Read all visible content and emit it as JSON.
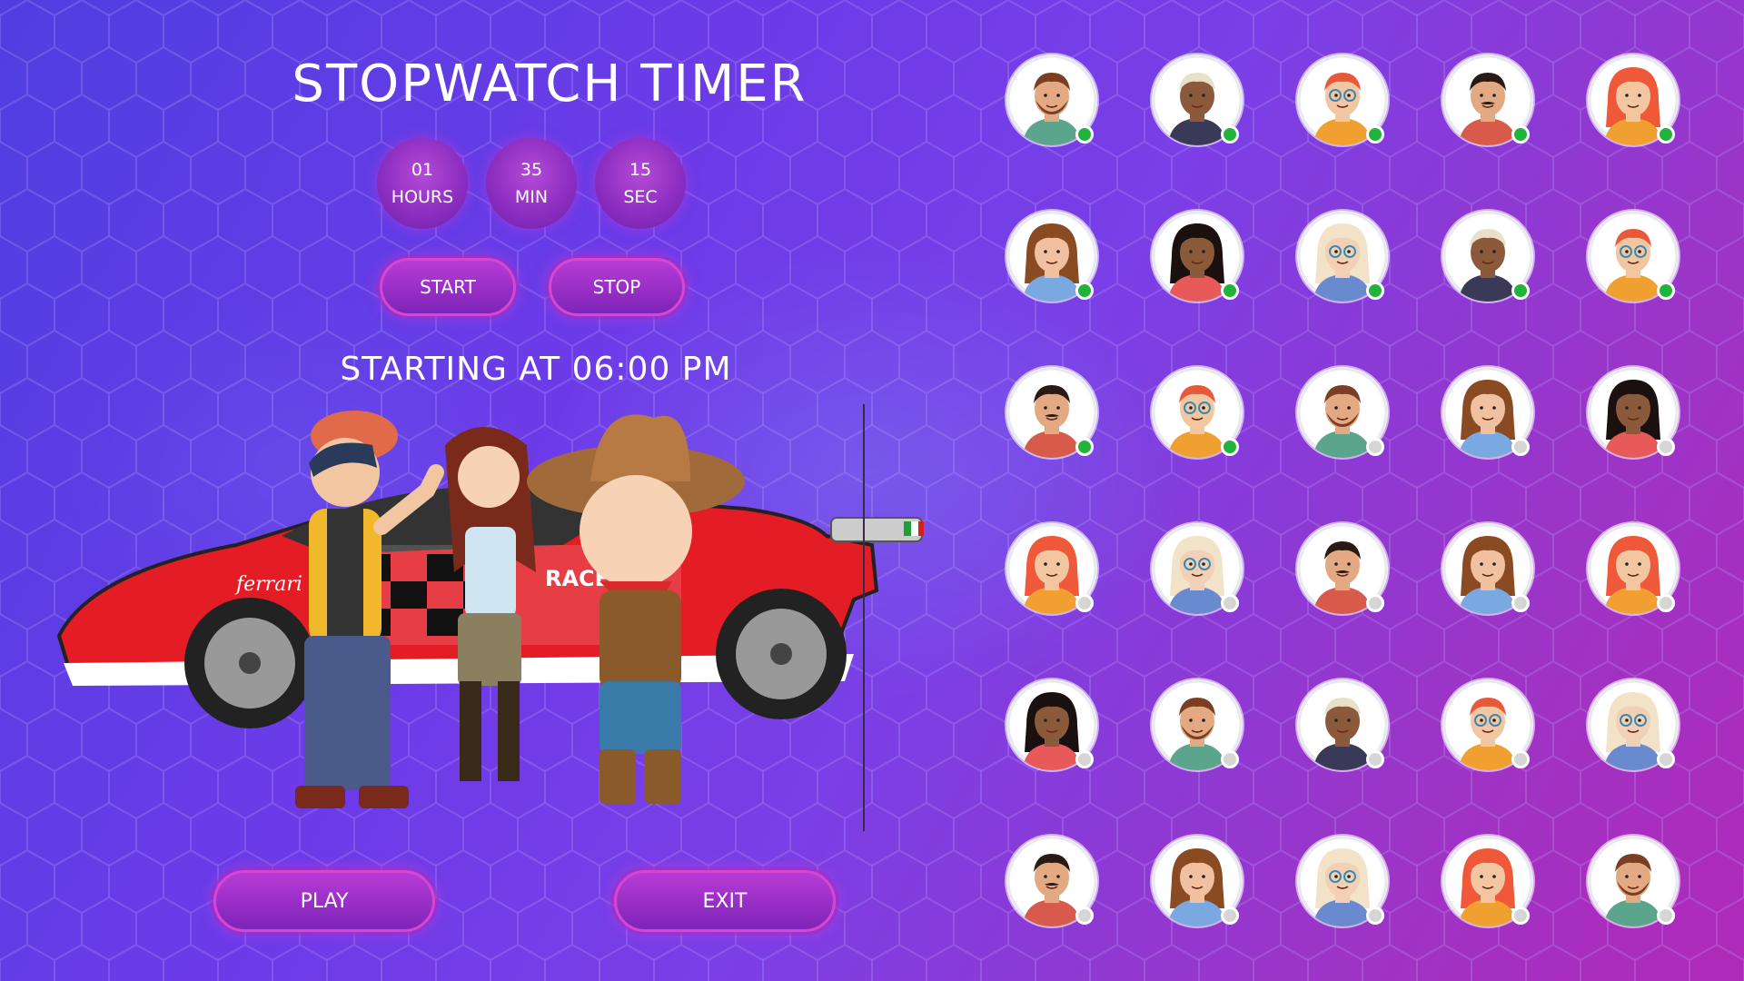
{
  "title": "STOPWATCH TIMER",
  "timer": [
    {
      "value": "01",
      "unit": "HOURS"
    },
    {
      "value": "35",
      "unit": "MIN"
    },
    {
      "value": "15",
      "unit": "SEC"
    }
  ],
  "controls": {
    "start_label": "START",
    "stop_label": "STOP"
  },
  "starting_text": "STARTING AT 06:00 PM",
  "scene": {
    "car_brand_text": "ferrari",
    "car_racer_text": "RACER"
  },
  "footer": {
    "play_label": "PLAY",
    "exit_label": "EXIT"
  },
  "colors": {
    "online": "#22b33a",
    "offline": "#d6d6d6",
    "accent": "#d746d0"
  },
  "players": [
    {
      "style": "beard-man",
      "online": true
    },
    {
      "style": "dark-blond-man",
      "online": true
    },
    {
      "style": "redhead-glasses",
      "online": true
    },
    {
      "style": "mustache-man",
      "online": true
    },
    {
      "style": "redhead-woman",
      "online": true
    },
    {
      "style": "brown-woman",
      "online": true
    },
    {
      "style": "curly-woman",
      "online": true
    },
    {
      "style": "blonde-glasses",
      "online": true
    },
    {
      "style": "dark-blond-man",
      "online": true
    },
    {
      "style": "redhead-glasses",
      "online": true
    },
    {
      "style": "mustache-man",
      "online": true
    },
    {
      "style": "redhead-glasses",
      "online": true
    },
    {
      "style": "beard-man",
      "online": false
    },
    {
      "style": "brown-woman",
      "online": false
    },
    {
      "style": "curly-woman",
      "online": false
    },
    {
      "style": "redhead-woman",
      "online": false
    },
    {
      "style": "blonde-glasses",
      "online": false
    },
    {
      "style": "mustache-man",
      "online": false
    },
    {
      "style": "brown-woman",
      "online": false
    },
    {
      "style": "redhead-woman",
      "online": false
    },
    {
      "style": "curly-woman",
      "online": false
    },
    {
      "style": "beard-man",
      "online": false
    },
    {
      "style": "dark-blond-man",
      "online": false
    },
    {
      "style": "redhead-glasses",
      "online": false
    },
    {
      "style": "blonde-glasses",
      "online": false
    },
    {
      "style": "mustache-man",
      "online": false
    },
    {
      "style": "brown-woman",
      "online": false
    },
    {
      "style": "blonde-glasses",
      "online": false
    },
    {
      "style": "redhead-woman",
      "online": false
    },
    {
      "style": "beard-man",
      "online": false
    }
  ]
}
